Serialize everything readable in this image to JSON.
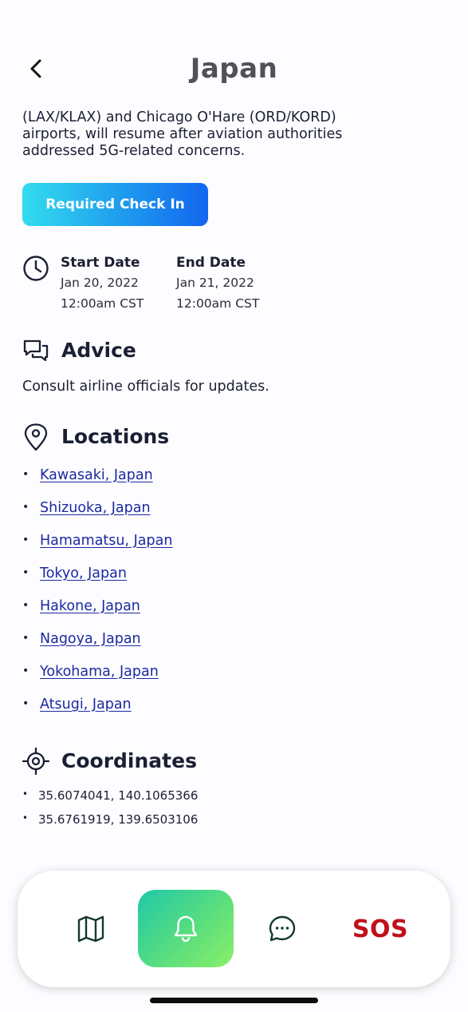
{
  "header": {
    "title": "Japan",
    "back_icon": "chevron-left-icon"
  },
  "alert": {
    "intro_line1": "(LAX/KLAX) and Chicago O'Hare (ORD/KORD)",
    "intro_line2": "airports, will resume after aviation authorities",
    "intro_line3": "addressed 5G-related concerns.",
    "checkin_label": "Required Check In",
    "start_label": "Start Date",
    "start_date": "Jan 20, 2022",
    "start_time": "12:00am CST",
    "end_label": "End Date",
    "end_date": "Jan 21, 2022",
    "end_time": "12:00am CST"
  },
  "advice": {
    "title": "Advice",
    "text": "Consult airline officials for updates."
  },
  "locations": {
    "title": "Locations",
    "items": [
      "Kawasaki, Japan",
      "Shizuoka, Japan",
      "Hamamatsu, Japan",
      "Tokyo, Japan",
      "Hakone, Japan",
      "Nagoya, Japan",
      "Yokohama, Japan",
      "Atsugi, Japan"
    ]
  },
  "coordinates": {
    "title": "Coordinates",
    "items": [
      "35.6074041, 140.1065366",
      "35.6761919, 139.6503106"
    ]
  },
  "nav": {
    "map_icon": "map-icon",
    "alerts_icon": "bell-icon",
    "chat_icon": "chat-bubble-icon",
    "sos_label": "SOS"
  },
  "colors": {
    "accent_blue": "#1266ee",
    "accent_cyan": "#33ddee",
    "nav_green": "#5ee07a",
    "sos_red": "#c0101a",
    "link_blue": "#1a2aa0"
  }
}
